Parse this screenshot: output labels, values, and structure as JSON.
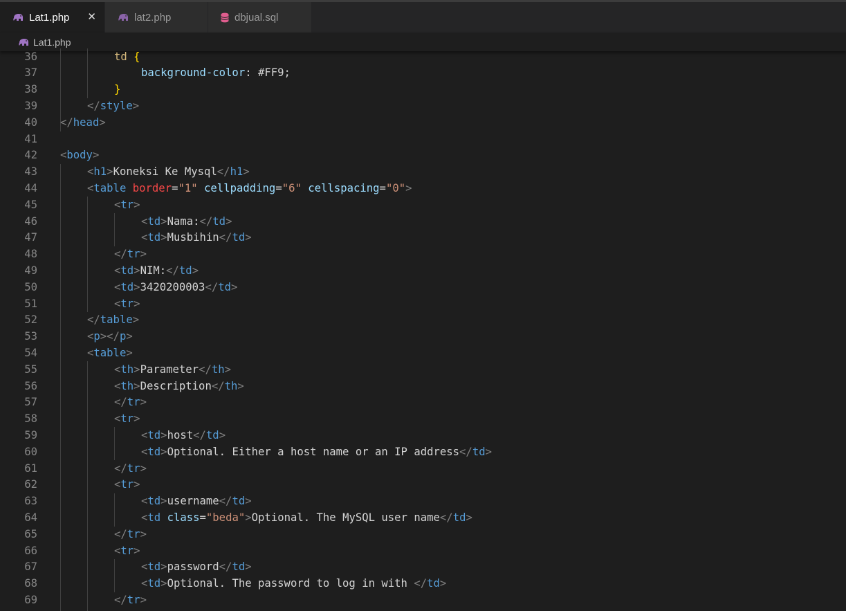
{
  "tabs": [
    {
      "label": "Lat1.php",
      "icon": "php-elephant-icon",
      "active": true,
      "close": "✕"
    },
    {
      "label": "lat2.php",
      "icon": "php-elephant-icon",
      "active": false
    },
    {
      "label": "dbjual.sql",
      "icon": "database-icon",
      "active": false
    }
  ],
  "breadcrumb": {
    "file": "Lat1.php",
    "icon": "php-elephant-icon"
  },
  "colors": {
    "background": "#1e1e1e",
    "tag": "#569cd6",
    "attribute": "#9cdcfe",
    "string": "#ce9178",
    "text": "#d4d4d4",
    "line_number": "#858585",
    "php_icon": "#a074c4",
    "sql_icon": "#e05d8e"
  },
  "lines": [
    {
      "n": "36",
      "t": [
        [
          "sel",
          "td "
        ],
        [
          "b",
          "{"
        ]
      ]
    },
    {
      "n": "37",
      "t": [
        [
          "a",
          "background-color"
        ],
        [
          "x",
          ": #FF9;"
        ]
      ]
    },
    {
      "n": "38",
      "t": [
        [
          "b",
          "}"
        ]
      ]
    },
    {
      "n": "39",
      "t": [
        [
          "p",
          "</"
        ],
        [
          "t",
          "style"
        ],
        [
          "p",
          ">"
        ]
      ]
    },
    {
      "n": "40",
      "t": [
        [
          "p",
          "</"
        ],
        [
          "t",
          "head"
        ],
        [
          "p",
          ">"
        ]
      ]
    },
    {
      "n": "41",
      "t": []
    },
    {
      "n": "42",
      "t": [
        [
          "p",
          "<"
        ],
        [
          "t",
          "body"
        ],
        [
          "p",
          ">"
        ]
      ]
    },
    {
      "n": "43",
      "t": [
        [
          "p",
          "<"
        ],
        [
          "t",
          "h1"
        ],
        [
          "p",
          ">"
        ],
        [
          "x",
          "Koneksi Ke Mysql"
        ],
        [
          "p",
          "</"
        ],
        [
          "t",
          "h1"
        ],
        [
          "p",
          ">"
        ]
      ]
    },
    {
      "n": "44",
      "t": [
        [
          "p",
          "<"
        ],
        [
          "t",
          "table "
        ],
        [
          "ar",
          "border"
        ],
        [
          "x",
          "="
        ],
        [
          "s",
          "\"1\""
        ],
        [
          "x",
          " "
        ],
        [
          "a",
          "cellpadding"
        ],
        [
          "x",
          "="
        ],
        [
          "s",
          "\"6\""
        ],
        [
          "x",
          " "
        ],
        [
          "a",
          "cellspacing"
        ],
        [
          "x",
          "="
        ],
        [
          "s",
          "\"0\""
        ],
        [
          "p",
          ">"
        ]
      ]
    },
    {
      "n": "45",
      "t": [
        [
          "p",
          "<"
        ],
        [
          "t",
          "tr"
        ],
        [
          "p",
          ">"
        ]
      ]
    },
    {
      "n": "46",
      "t": [
        [
          "p",
          "<"
        ],
        [
          "t",
          "td"
        ],
        [
          "p",
          ">"
        ],
        [
          "x",
          "Nama:"
        ],
        [
          "p",
          "</"
        ],
        [
          "t",
          "td"
        ],
        [
          "p",
          ">"
        ]
      ]
    },
    {
      "n": "47",
      "t": [
        [
          "p",
          "<"
        ],
        [
          "t",
          "td"
        ],
        [
          "p",
          ">"
        ],
        [
          "x",
          "Musbihin"
        ],
        [
          "p",
          "</"
        ],
        [
          "t",
          "td"
        ],
        [
          "p",
          ">"
        ]
      ]
    },
    {
      "n": "48",
      "t": [
        [
          "p",
          "</"
        ],
        [
          "t",
          "tr"
        ],
        [
          "p",
          ">"
        ]
      ]
    },
    {
      "n": "49",
      "t": [
        [
          "p",
          "<"
        ],
        [
          "t",
          "td"
        ],
        [
          "p",
          ">"
        ],
        [
          "x",
          "NIM:"
        ],
        [
          "p",
          "</"
        ],
        [
          "t",
          "td"
        ],
        [
          "p",
          ">"
        ]
      ]
    },
    {
      "n": "50",
      "t": [
        [
          "p",
          "<"
        ],
        [
          "t",
          "td"
        ],
        [
          "p",
          ">"
        ],
        [
          "x",
          "3420200003"
        ],
        [
          "p",
          "</"
        ],
        [
          "t",
          "td"
        ],
        [
          "p",
          ">"
        ]
      ]
    },
    {
      "n": "51",
      "t": [
        [
          "p",
          "<"
        ],
        [
          "t",
          "tr"
        ],
        [
          "p",
          ">"
        ]
      ]
    },
    {
      "n": "52",
      "t": [
        [
          "p",
          "</"
        ],
        [
          "t",
          "table"
        ],
        [
          "p",
          ">"
        ]
      ]
    },
    {
      "n": "53",
      "t": [
        [
          "p",
          "<"
        ],
        [
          "t",
          "p"
        ],
        [
          "p",
          "></"
        ],
        [
          "t",
          "p"
        ],
        [
          "p",
          ">"
        ]
      ]
    },
    {
      "n": "54",
      "t": [
        [
          "p",
          "<"
        ],
        [
          "t",
          "table"
        ],
        [
          "p",
          ">"
        ]
      ]
    },
    {
      "n": "55",
      "t": [
        [
          "p",
          "<"
        ],
        [
          "t",
          "th"
        ],
        [
          "p",
          ">"
        ],
        [
          "x",
          "Parameter"
        ],
        [
          "p",
          "</"
        ],
        [
          "t",
          "th"
        ],
        [
          "p",
          ">"
        ]
      ]
    },
    {
      "n": "56",
      "t": [
        [
          "p",
          "<"
        ],
        [
          "t",
          "th"
        ],
        [
          "p",
          ">"
        ],
        [
          "x",
          "Description"
        ],
        [
          "p",
          "</"
        ],
        [
          "t",
          "th"
        ],
        [
          "p",
          ">"
        ]
      ]
    },
    {
      "n": "57",
      "t": [
        [
          "p",
          "</"
        ],
        [
          "t",
          "tr"
        ],
        [
          "p",
          ">"
        ]
      ]
    },
    {
      "n": "58",
      "t": [
        [
          "p",
          "<"
        ],
        [
          "t",
          "tr"
        ],
        [
          "p",
          ">"
        ]
      ]
    },
    {
      "n": "59",
      "t": [
        [
          "p",
          "<"
        ],
        [
          "t",
          "td"
        ],
        [
          "p",
          ">"
        ],
        [
          "x",
          "host"
        ],
        [
          "p",
          "</"
        ],
        [
          "t",
          "td"
        ],
        [
          "p",
          ">"
        ]
      ]
    },
    {
      "n": "60",
      "t": [
        [
          "p",
          "<"
        ],
        [
          "t",
          "td"
        ],
        [
          "p",
          ">"
        ],
        [
          "x",
          "Optional. Either a host name or an IP address"
        ],
        [
          "p",
          "</"
        ],
        [
          "t",
          "td"
        ],
        [
          "p",
          ">"
        ]
      ]
    },
    {
      "n": "61",
      "t": [
        [
          "p",
          "</"
        ],
        [
          "t",
          "tr"
        ],
        [
          "p",
          ">"
        ]
      ]
    },
    {
      "n": "62",
      "t": [
        [
          "p",
          "<"
        ],
        [
          "t",
          "tr"
        ],
        [
          "p",
          ">"
        ]
      ]
    },
    {
      "n": "63",
      "t": [
        [
          "p",
          "<"
        ],
        [
          "t",
          "td"
        ],
        [
          "p",
          ">"
        ],
        [
          "x",
          "username"
        ],
        [
          "p",
          "</"
        ],
        [
          "t",
          "td"
        ],
        [
          "p",
          ">"
        ]
      ]
    },
    {
      "n": "64",
      "t": [
        [
          "p",
          "<"
        ],
        [
          "t",
          "td "
        ],
        [
          "a",
          "class"
        ],
        [
          "x",
          "="
        ],
        [
          "s",
          "\"beda\""
        ],
        [
          "p",
          ">"
        ],
        [
          "x",
          "Optional. The MySQL user name"
        ],
        [
          "p",
          "</"
        ],
        [
          "t",
          "td"
        ],
        [
          "p",
          ">"
        ]
      ]
    },
    {
      "n": "65",
      "t": [
        [
          "p",
          "</"
        ],
        [
          "t",
          "tr"
        ],
        [
          "p",
          ">"
        ]
      ]
    },
    {
      "n": "66",
      "t": [
        [
          "p",
          "<"
        ],
        [
          "t",
          "tr"
        ],
        [
          "p",
          ">"
        ]
      ]
    },
    {
      "n": "67",
      "t": [
        [
          "p",
          "<"
        ],
        [
          "t",
          "td"
        ],
        [
          "p",
          ">"
        ],
        [
          "x",
          "password"
        ],
        [
          "p",
          "</"
        ],
        [
          "t",
          "td"
        ],
        [
          "p",
          ">"
        ]
      ]
    },
    {
      "n": "68",
      "t": [
        [
          "p",
          "<"
        ],
        [
          "t",
          "td"
        ],
        [
          "p",
          ">"
        ],
        [
          "x",
          "Optional. The password to log in with "
        ],
        [
          "p",
          "</"
        ],
        [
          "t",
          "td"
        ],
        [
          "p",
          ">"
        ]
      ]
    },
    {
      "n": "69",
      "t": [
        [
          "p",
          "</"
        ],
        [
          "t",
          "tr"
        ],
        [
          "p",
          ">"
        ]
      ]
    }
  ]
}
